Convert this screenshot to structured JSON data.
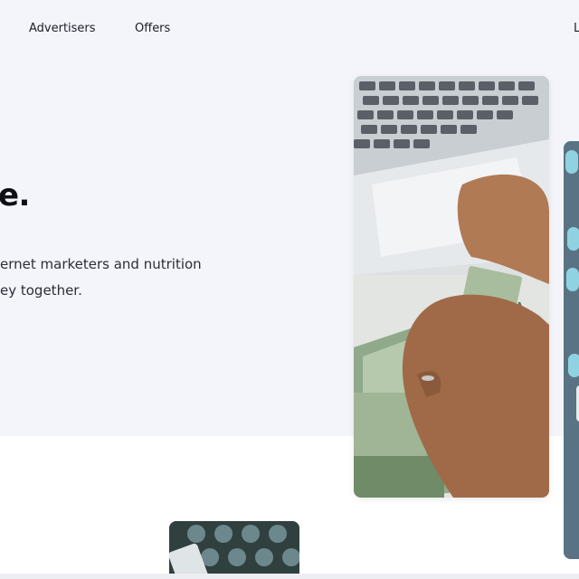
{
  "nav": {
    "advertisers": "Advertisers",
    "offers": "Offers",
    "login": "L"
  },
  "hero": {
    "headline": "e.",
    "subtext_line1": "ernet marketers and nutrition",
    "subtext_line2": "ey together."
  },
  "images": {
    "money_card": "hands-counting-dollar-bills-image",
    "pills_card": "medicine-capsules-image",
    "bottom_card": "pill-bottles-image"
  },
  "colors": {
    "hero_background": "#f4f5fb",
    "text_dark": "#0d0f14"
  }
}
